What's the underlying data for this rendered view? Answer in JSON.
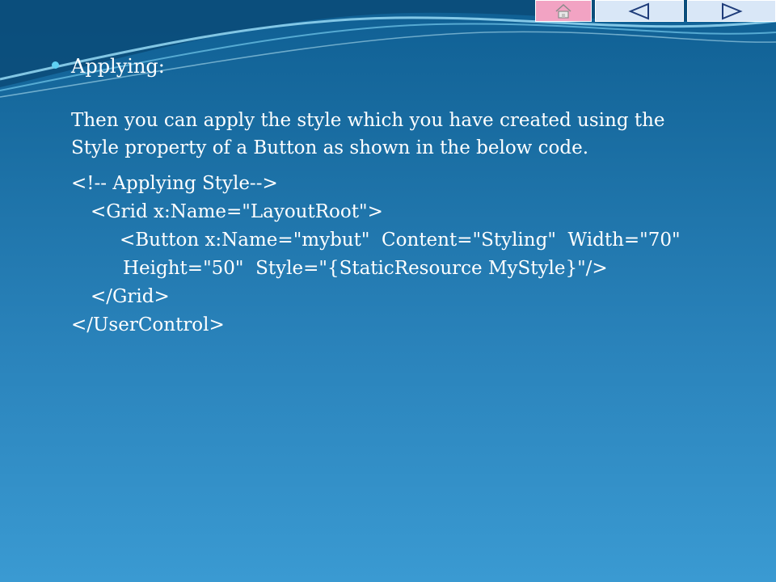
{
  "slide": {
    "heading": "Applying:",
    "paragraph_line1": "Then you can apply the style which you have created using the",
    "paragraph_line2": "Style property of a Button as shown in the below code.",
    "code_lines": [
      "<!-- Applying Style-->",
      "<Grid x:Name=\"LayoutRoot\">",
      "<Button x:Name=\"mybut\"  Content=\"Styling\"  Width=\"70\"",
      "Height=\"50\"  Style=\"{StaticResource MyStyle}\"/>",
      "</Grid>",
      "</UserControl>"
    ]
  },
  "nav": {
    "home_icon": "home-icon",
    "prev_icon": "previous-triangle-icon",
    "next_icon": "next-triangle-icon"
  },
  "colors": {
    "background_top": "#0f5f93",
    "background_bottom": "#3a9ad2",
    "bullet": "#5fd0f3",
    "home_button": "#f2a3c3",
    "nav_button": "#d9e7f7",
    "text": "#ffffff"
  }
}
